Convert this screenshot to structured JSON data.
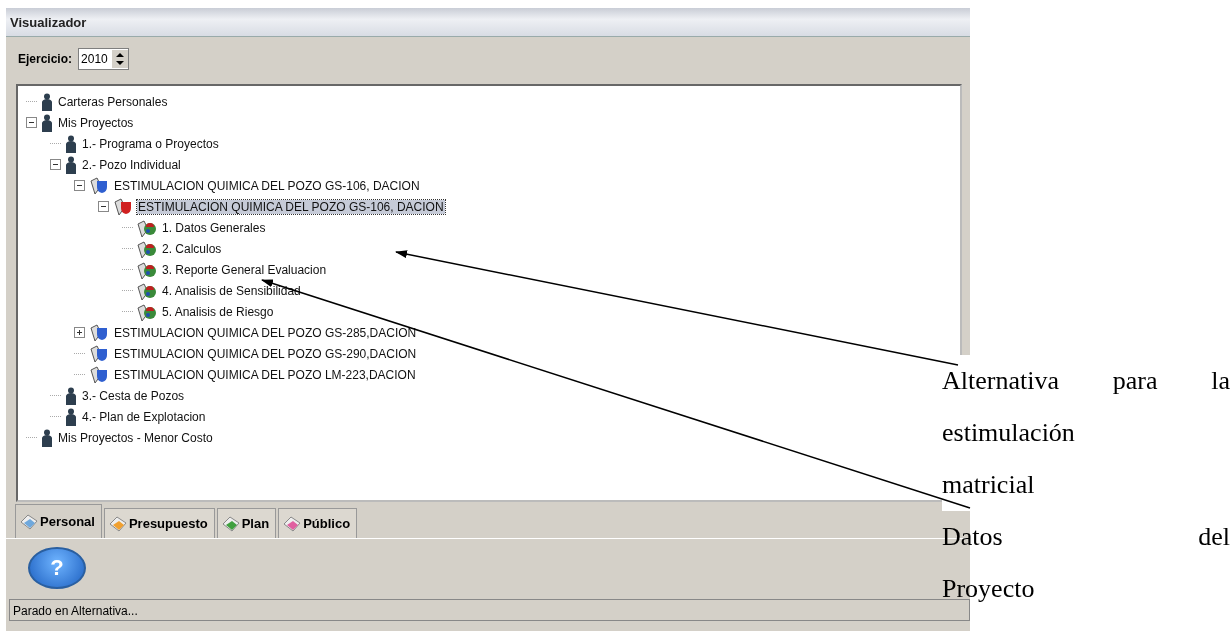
{
  "window": {
    "title": "Visualizador"
  },
  "toolbar": {
    "label": "Ejercicio:",
    "year": "2010"
  },
  "tree": [
    {
      "label": "Carteras Personales",
      "kind": "person",
      "selected": false
    },
    {
      "label": "Mis Proyectos",
      "kind": "person",
      "selected": false,
      "expanded": true,
      "children": [
        {
          "label": "1.- Programa o Proyectos",
          "kind": "person",
          "selected": false
        },
        {
          "label": "2.- Pozo Individual",
          "kind": "person",
          "selected": false,
          "expanded": true,
          "children": [
            {
              "label": "ESTIMULACION QUIMICA DEL POZO GS-106, DACION",
              "kind": "project",
              "selected": false,
              "expanded": true,
              "children": [
                {
                  "label": "ESTIMULACION QUIMICA DEL POZO GS-106, DACION",
                  "kind": "alternative",
                  "selected": true,
                  "expanded": true,
                  "children": [
                    {
                      "label": "1. Datos Generales",
                      "kind": "module",
                      "selected": false
                    },
                    {
                      "label": "2. Calculos",
                      "kind": "module",
                      "selected": false
                    },
                    {
                      "label": "3. Reporte General Evaluacion",
                      "kind": "module",
                      "selected": false
                    },
                    {
                      "label": "4. Analisis de Sensibilidad",
                      "kind": "module",
                      "selected": false
                    },
                    {
                      "label": "5. Analisis de Riesgo",
                      "kind": "module",
                      "selected": false
                    }
                  ]
                }
              ]
            },
            {
              "label": "ESTIMULACION QUIMICA DEL POZO GS-285,DACION",
              "kind": "project",
              "selected": false,
              "expanded": false
            },
            {
              "label": "ESTIMULACION QUIMICA DEL POZO GS-290,DACION",
              "kind": "project",
              "selected": false
            },
            {
              "label": "ESTIMULACION QUIMICA DEL POZO LM-223,DACION",
              "kind": "project",
              "selected": false
            }
          ]
        },
        {
          "label": "3.- Cesta de Pozos",
          "kind": "person",
          "selected": false
        },
        {
          "label": "4.- Plan de Explotacion",
          "kind": "person",
          "selected": false
        }
      ]
    },
    {
      "label": "Mis Proyectos - Menor Costo",
      "kind": "person",
      "selected": false
    }
  ],
  "tabs": [
    {
      "label": "Personal",
      "selected": true,
      "color": "#6fa8dc"
    },
    {
      "label": "Presupuesto",
      "selected": false,
      "color": "#f0a030"
    },
    {
      "label": "Plan",
      "selected": false,
      "color": "#40a040"
    },
    {
      "label": "Público",
      "selected": false,
      "color": "#e060a0"
    }
  ],
  "help_button": {
    "label": "?"
  },
  "status_bar": "Parado en Alternativa...",
  "callouts": [
    {
      "lines": [
        "Alternativa para la",
        "estimulación",
        "matricial"
      ]
    },
    {
      "lines": [
        "Datos del",
        "Proyecto"
      ]
    }
  ]
}
